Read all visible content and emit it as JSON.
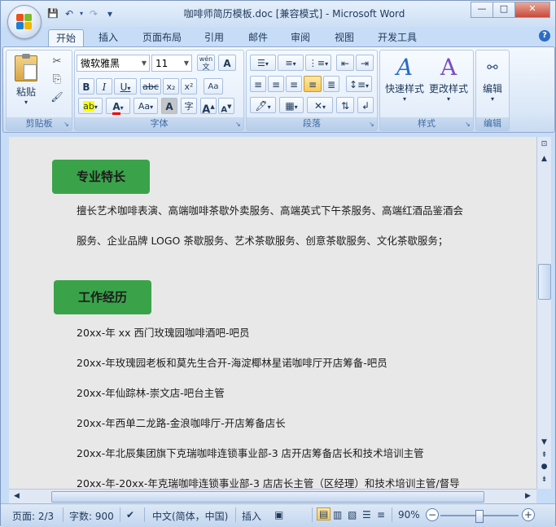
{
  "window": {
    "title": "咖啡师简历模板.doc [兼容模式] - Microsoft Word",
    "controls": {
      "minimize": "—",
      "maximize": "□",
      "close": "✕"
    }
  },
  "quick_access": {
    "save": "💾",
    "undo": "↶",
    "redo": "↷",
    "customize": "▾"
  },
  "tabs": [
    "开始",
    "插入",
    "页面布局",
    "引用",
    "邮件",
    "审阅",
    "视图",
    "开发工具"
  ],
  "active_tab": "开始",
  "ribbon": {
    "clipboard": {
      "label": "剪贴板",
      "paste": "粘贴",
      "cut_icon": "✂",
      "copy_icon": "⎘",
      "painter_icon": "🖌"
    },
    "font": {
      "label": "字体",
      "font_name": "微软雅黑",
      "font_size": "11",
      "grow": "A",
      "shrink": "A",
      "bold": "B",
      "italic": "I",
      "underline": "U",
      "strike": "abc",
      "sub": "x₂",
      "sup": "x²",
      "clear": "Aa",
      "highlight": "ab",
      "color": "A",
      "case": "Aa",
      "charshade": "A",
      "enclose": "字"
    },
    "paragraph": {
      "label": "段落"
    },
    "styles": {
      "label": "样式",
      "quick_styles": "快速样式",
      "change_styles": "更改样式"
    },
    "editing": {
      "label": "编辑",
      "edit": "编辑"
    }
  },
  "document": {
    "heading1": "专业特长",
    "skills_line1": "擅长艺术咖啡表演、高端咖啡茶歇外卖服务、高端英式下午茶服务、高端红酒品鉴酒会",
    "skills_line2": "服务、企业品牌 LOGO 茶歇服务、艺术茶歇服务、创意茶歇服务、文化茶歇服务；",
    "heading2": "工作经历",
    "experience": [
      "20xx-年 xx 西门玫瑰园咖啡酒吧-吧员",
      "20xx-年玫瑰园老板和莫先生合开-海淀椰林星诺咖啡厅开店筹备-吧员",
      "20xx-年仙踪林-崇文店-吧台主管",
      "20xx-年西单二龙路-金浪咖啡厅-开店筹备店长",
      "20xx-年北辰集团旗下克瑞咖啡连锁事业部-3 店开店筹备店长和技术培训主管",
      "20xx-年-20xx-年克瑞咖啡连锁事业部-3 店店长主管（区经理）和技术培训主管/督导"
    ]
  },
  "status": {
    "page": "页面: 2/3",
    "words": "字数: 900",
    "language": "中文(简体，中国)",
    "mode": "插入",
    "zoom": "90%",
    "zoom_level": 0.5
  }
}
